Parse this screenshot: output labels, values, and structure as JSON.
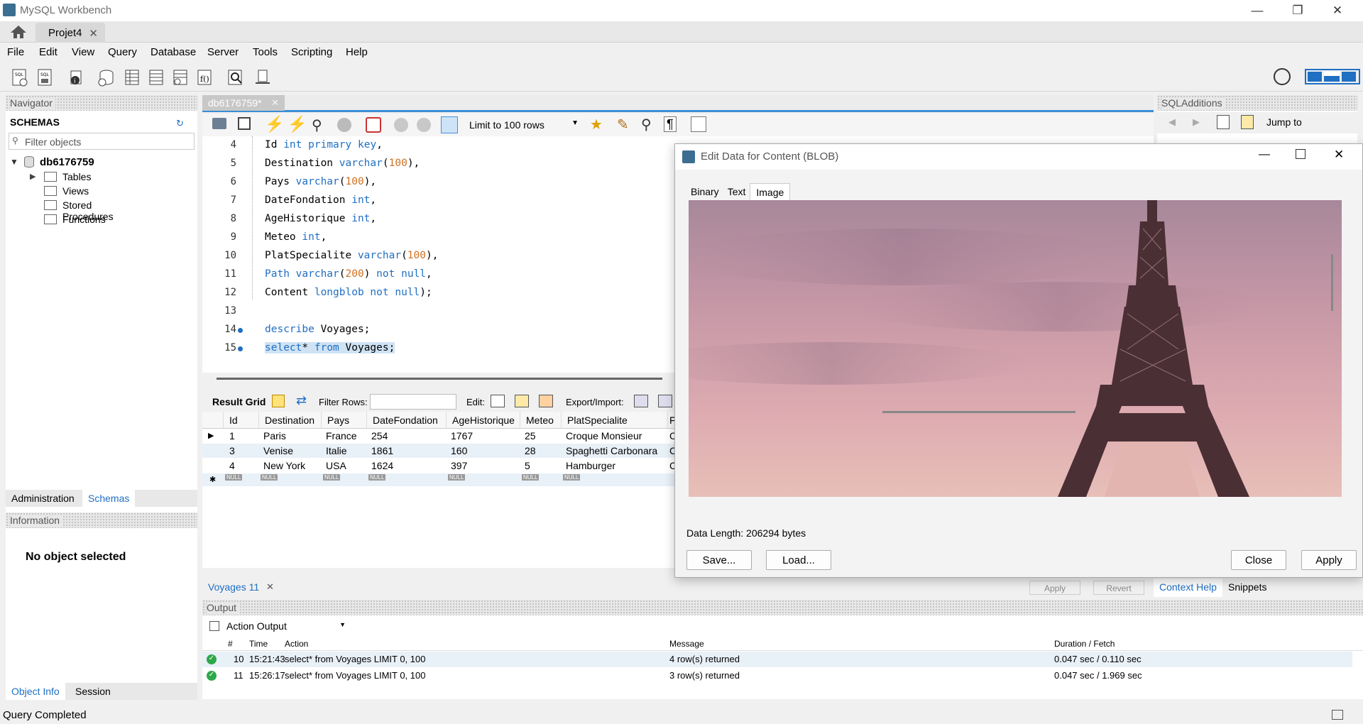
{
  "app": {
    "title": "MySQL Workbench",
    "connection_tab": "Projet4"
  },
  "menus": [
    "File",
    "Edit",
    "View",
    "Query",
    "Database",
    "Server",
    "Tools",
    "Scripting",
    "Help"
  ],
  "navigator": {
    "title": "Navigator",
    "schemas_label": "SCHEMAS",
    "filter_placeholder": "Filter objects",
    "schema": "db6176759",
    "nodes": [
      "Tables",
      "Views",
      "Stored Procedures",
      "Functions"
    ],
    "tab_admin": "Administration",
    "tab_schemas": "Schemas",
    "info_title": "Information",
    "info_text": "No object selected",
    "tab_object_info": "Object Info",
    "tab_session": "Session"
  },
  "editor": {
    "tab": "db6176759*",
    "limit": "Limit to 100 rows",
    "lines": [
      {
        "n": "4",
        "text": "Id int primary key,"
      },
      {
        "n": "5",
        "text": "Destination varchar(100),"
      },
      {
        "n": "6",
        "text": "Pays varchar(100),"
      },
      {
        "n": "7",
        "text": "DateFondation int,"
      },
      {
        "n": "8",
        "text": "AgeHistorique int,"
      },
      {
        "n": "9",
        "text": "Meteo int,"
      },
      {
        "n": "10",
        "text": "PlatSpecialite varchar(100),"
      },
      {
        "n": "11",
        "text": "Path varchar(200) not null,"
      },
      {
        "n": "12",
        "text": "Content longblob not null);"
      },
      {
        "n": "13",
        "text": ""
      },
      {
        "n": "14",
        "text": "describe Voyages;"
      },
      {
        "n": "15",
        "text": "select* from Voyages;"
      }
    ]
  },
  "result": {
    "grid_label": "Result Grid",
    "filter_label": "Filter Rows:",
    "edit_label": "Edit:",
    "export_label": "Export/Import:",
    "columns": [
      "Id",
      "Destination",
      "Pays",
      "DateFondation",
      "AgeHistorique",
      "Meteo",
      "PlatSpecialite",
      "F"
    ],
    "rows": [
      [
        "1",
        "Paris",
        "France",
        "254",
        "1767",
        "25",
        "Croque Monsieur",
        "C"
      ],
      [
        "3",
        "Venise",
        "Italie",
        "1861",
        "160",
        "28",
        "Spaghetti Carbonara",
        "C"
      ],
      [
        "4",
        "New York",
        "USA",
        "1624",
        "397",
        "5",
        "Hamburger",
        "C"
      ]
    ],
    "null_label": "NULL",
    "result_tab": "Voyages 11"
  },
  "sql_additions": {
    "title": "SQLAdditions",
    "jump_to": "Jump to"
  },
  "lower_right": {
    "apply": "Apply",
    "revert": "Revert",
    "context_help": "Context Help",
    "snippets": "Snippets"
  },
  "output": {
    "title": "Output",
    "selector": "Action Output",
    "headers": [
      "#",
      "Time",
      "Action",
      "Message",
      "Duration / Fetch"
    ],
    "rows": [
      {
        "n": "10",
        "time": "15:21:43",
        "action": "select* from Voyages LIMIT 0, 100",
        "message": "4 row(s) returned",
        "duration": "0.047 sec / 0.110 sec"
      },
      {
        "n": "11",
        "time": "15:26:17",
        "action": "select* from Voyages LIMIT 0, 100",
        "message": "3 row(s) returned",
        "duration": "0.047 sec / 1.969 sec"
      }
    ]
  },
  "status": "Query Completed",
  "dialog": {
    "title": "Edit Data for Content (BLOB)",
    "tabs": [
      "Binary",
      "Text",
      "Image"
    ],
    "active_tab": "Image",
    "data_length": "Data Length: 206294 bytes",
    "save": "Save...",
    "load": "Load...",
    "close": "Close",
    "apply": "Apply"
  },
  "colors": {
    "accent": "#1f6fc3",
    "number": "#d07020",
    "ok": "#2ea84a"
  }
}
